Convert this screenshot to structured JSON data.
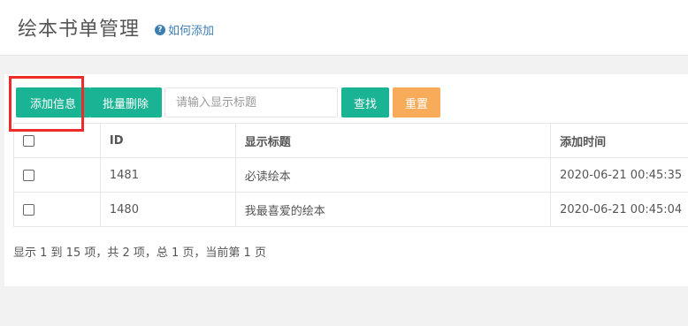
{
  "header": {
    "title": "绘本书单管理",
    "help_icon": "question-circle-icon",
    "help_label": "如何添加"
  },
  "toolbar": {
    "add_label": "添加信息",
    "batch_delete_label": "批量删除",
    "search_placeholder": "请输入显示标题",
    "search_label": "查找",
    "reset_label": "重置"
  },
  "table": {
    "columns": [
      "",
      "ID",
      "显示标题",
      "添加时间"
    ],
    "rows": [
      {
        "id": "1481",
        "title": "必读绘本",
        "added": "2020-06-21 00:45:35"
      },
      {
        "id": "1480",
        "title": "我最喜爱的绘本",
        "added": "2020-06-21 00:45:04"
      }
    ]
  },
  "pagination": {
    "info": "显示 1 到 15 项，共 2 项，总 1 页，当前第 1 页"
  },
  "colors": {
    "primary": "#1ab394",
    "warning": "#f8ac59",
    "highlight": "#ee2b2b",
    "link": "#3d7fb3"
  }
}
